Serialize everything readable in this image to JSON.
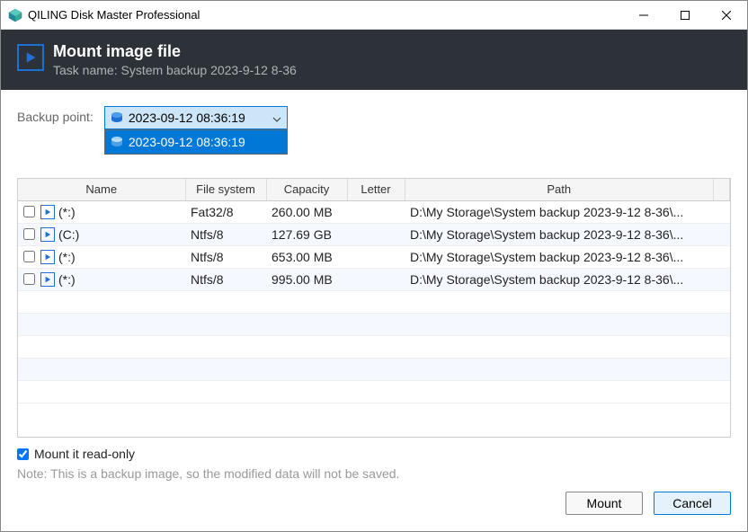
{
  "window": {
    "title": "QILING Disk Master Professional"
  },
  "header": {
    "title": "Mount image file",
    "subtitle": "Task name: System backup 2023-9-12 8-36"
  },
  "backup_point": {
    "label": "Backup point:",
    "selected": "2023-09-12 08:36:19",
    "options": [
      "2023-09-12 08:36:19"
    ]
  },
  "table": {
    "headers": {
      "name": "Name",
      "filesystem": "File system",
      "capacity": "Capacity",
      "letter": "Letter",
      "path": "Path"
    },
    "rows": [
      {
        "checked": false,
        "name": "(*:)",
        "filesystem": "Fat32/8",
        "capacity": "260.00 MB",
        "letter": "",
        "path": "D:\\My Storage\\System backup 2023-9-12 8-36\\..."
      },
      {
        "checked": false,
        "name": "(C:)",
        "filesystem": "Ntfs/8",
        "capacity": "127.69 GB",
        "letter": "",
        "path": "D:\\My Storage\\System backup 2023-9-12 8-36\\..."
      },
      {
        "checked": false,
        "name": "(*:)",
        "filesystem": "Ntfs/8",
        "capacity": "653.00 MB",
        "letter": "",
        "path": "D:\\My Storage\\System backup 2023-9-12 8-36\\..."
      },
      {
        "checked": false,
        "name": "(*:)",
        "filesystem": "Ntfs/8",
        "capacity": "995.00 MB",
        "letter": "",
        "path": "D:\\My Storage\\System backup 2023-9-12 8-36\\..."
      }
    ]
  },
  "readonly": {
    "checked": true,
    "label": "Mount it read-only"
  },
  "note": "Note: This is a backup image, so the modified data will not be saved.",
  "buttons": {
    "mount": "Mount",
    "cancel": "Cancel"
  }
}
